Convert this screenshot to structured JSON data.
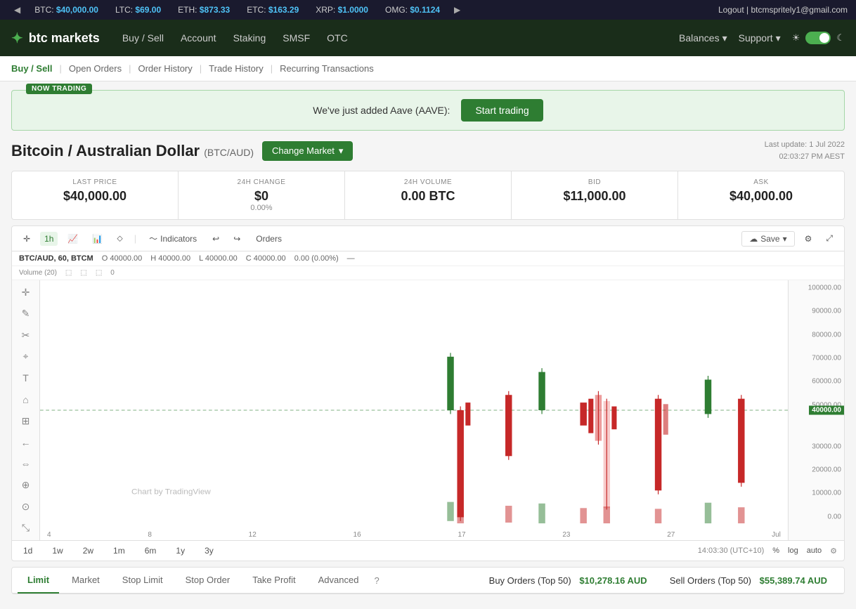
{
  "ticker": {
    "items": [
      {
        "label": "BTC:",
        "value": "$40,000.00"
      },
      {
        "label": "LTC:",
        "value": "$69.00"
      },
      {
        "label": "ETH:",
        "value": "$873.33"
      },
      {
        "label": "ETC:",
        "value": "$163.29"
      },
      {
        "label": "XRP:",
        "value": "$1.0000"
      },
      {
        "label": "OMG:",
        "value": "$0.1124"
      }
    ],
    "auth": "Logout | btcmspritely1@gmail.com"
  },
  "nav": {
    "logo": "btc markets",
    "links": [
      "Buy / Sell",
      "Account",
      "Staking",
      "SMSF",
      "OTC"
    ],
    "right": [
      "Balances",
      "Support"
    ]
  },
  "subnav": {
    "links": [
      "Buy / Sell",
      "Open Orders",
      "Order History",
      "Trade History",
      "Recurring Transactions"
    ]
  },
  "banner": {
    "tag": "NOW TRADING",
    "text": "We've just added Aave (AAVE):",
    "btn": "Start trading"
  },
  "market": {
    "title": "Bitcoin / Australian Dollar",
    "pair": "(BTC/AUD)",
    "change_btn": "Change Market",
    "last_update": "Last update: 1 Jul 2022",
    "last_update_time": "02:03:27 PM AEST"
  },
  "stats": {
    "last_price": {
      "label": "LAST PRICE",
      "value": "$40,000.00"
    },
    "change_24h": {
      "label": "24H CHANGE",
      "value": "$0",
      "sub": "0.00%"
    },
    "volume_24h": {
      "label": "24H VOLUME",
      "value": "0.00 BTC"
    },
    "bid": {
      "label": "BID",
      "value": "$11,000.00"
    },
    "ask": {
      "label": "ASK",
      "value": "$40,000.00"
    }
  },
  "chart": {
    "timeframes": [
      "1h",
      "1d",
      "1w",
      "2w",
      "1m",
      "6m",
      "1y",
      "3y"
    ],
    "active_tf": "1h",
    "indicators_label": "Indicators",
    "orders_label": "Orders",
    "save_label": "Save",
    "symbol": "BTC/AUD, 60, BTCM",
    "o": "40000.00",
    "h": "40000.00",
    "l": "40000.00",
    "c": "40000.00",
    "change": "0.00 (0.00%)",
    "volume_label": "Volume (20)",
    "volume_val": "0",
    "y_labels": [
      "100000.00",
      "90000.00",
      "80000.00",
      "70000.00",
      "60000.00",
      "50000.00",
      "40000.00",
      "30000.00",
      "20000.00",
      "10000.00",
      "0.00"
    ],
    "current_price": "40000.00",
    "x_labels": [
      "4",
      "8",
      "12",
      "16",
      "17",
      "23",
      "27",
      "Jul"
    ],
    "bottom_time": "14:03:30 (UTC+10)",
    "bottom_options": [
      "%",
      "log",
      "auto"
    ],
    "range_btns": [
      "1d",
      "1w",
      "2w",
      "1m",
      "6m",
      "1y",
      "3y"
    ]
  },
  "order_tabs": {
    "tabs": [
      "Limit",
      "Market",
      "Stop Limit",
      "Stop Order",
      "Take Profit",
      "Advanced"
    ]
  },
  "order_books": {
    "buy": {
      "title": "Buy Orders (Top 50)",
      "total": "$10,278.16 AUD"
    },
    "sell": {
      "title": "Sell Orders (Top 50)",
      "total": "$55,389.74 AUD"
    }
  }
}
